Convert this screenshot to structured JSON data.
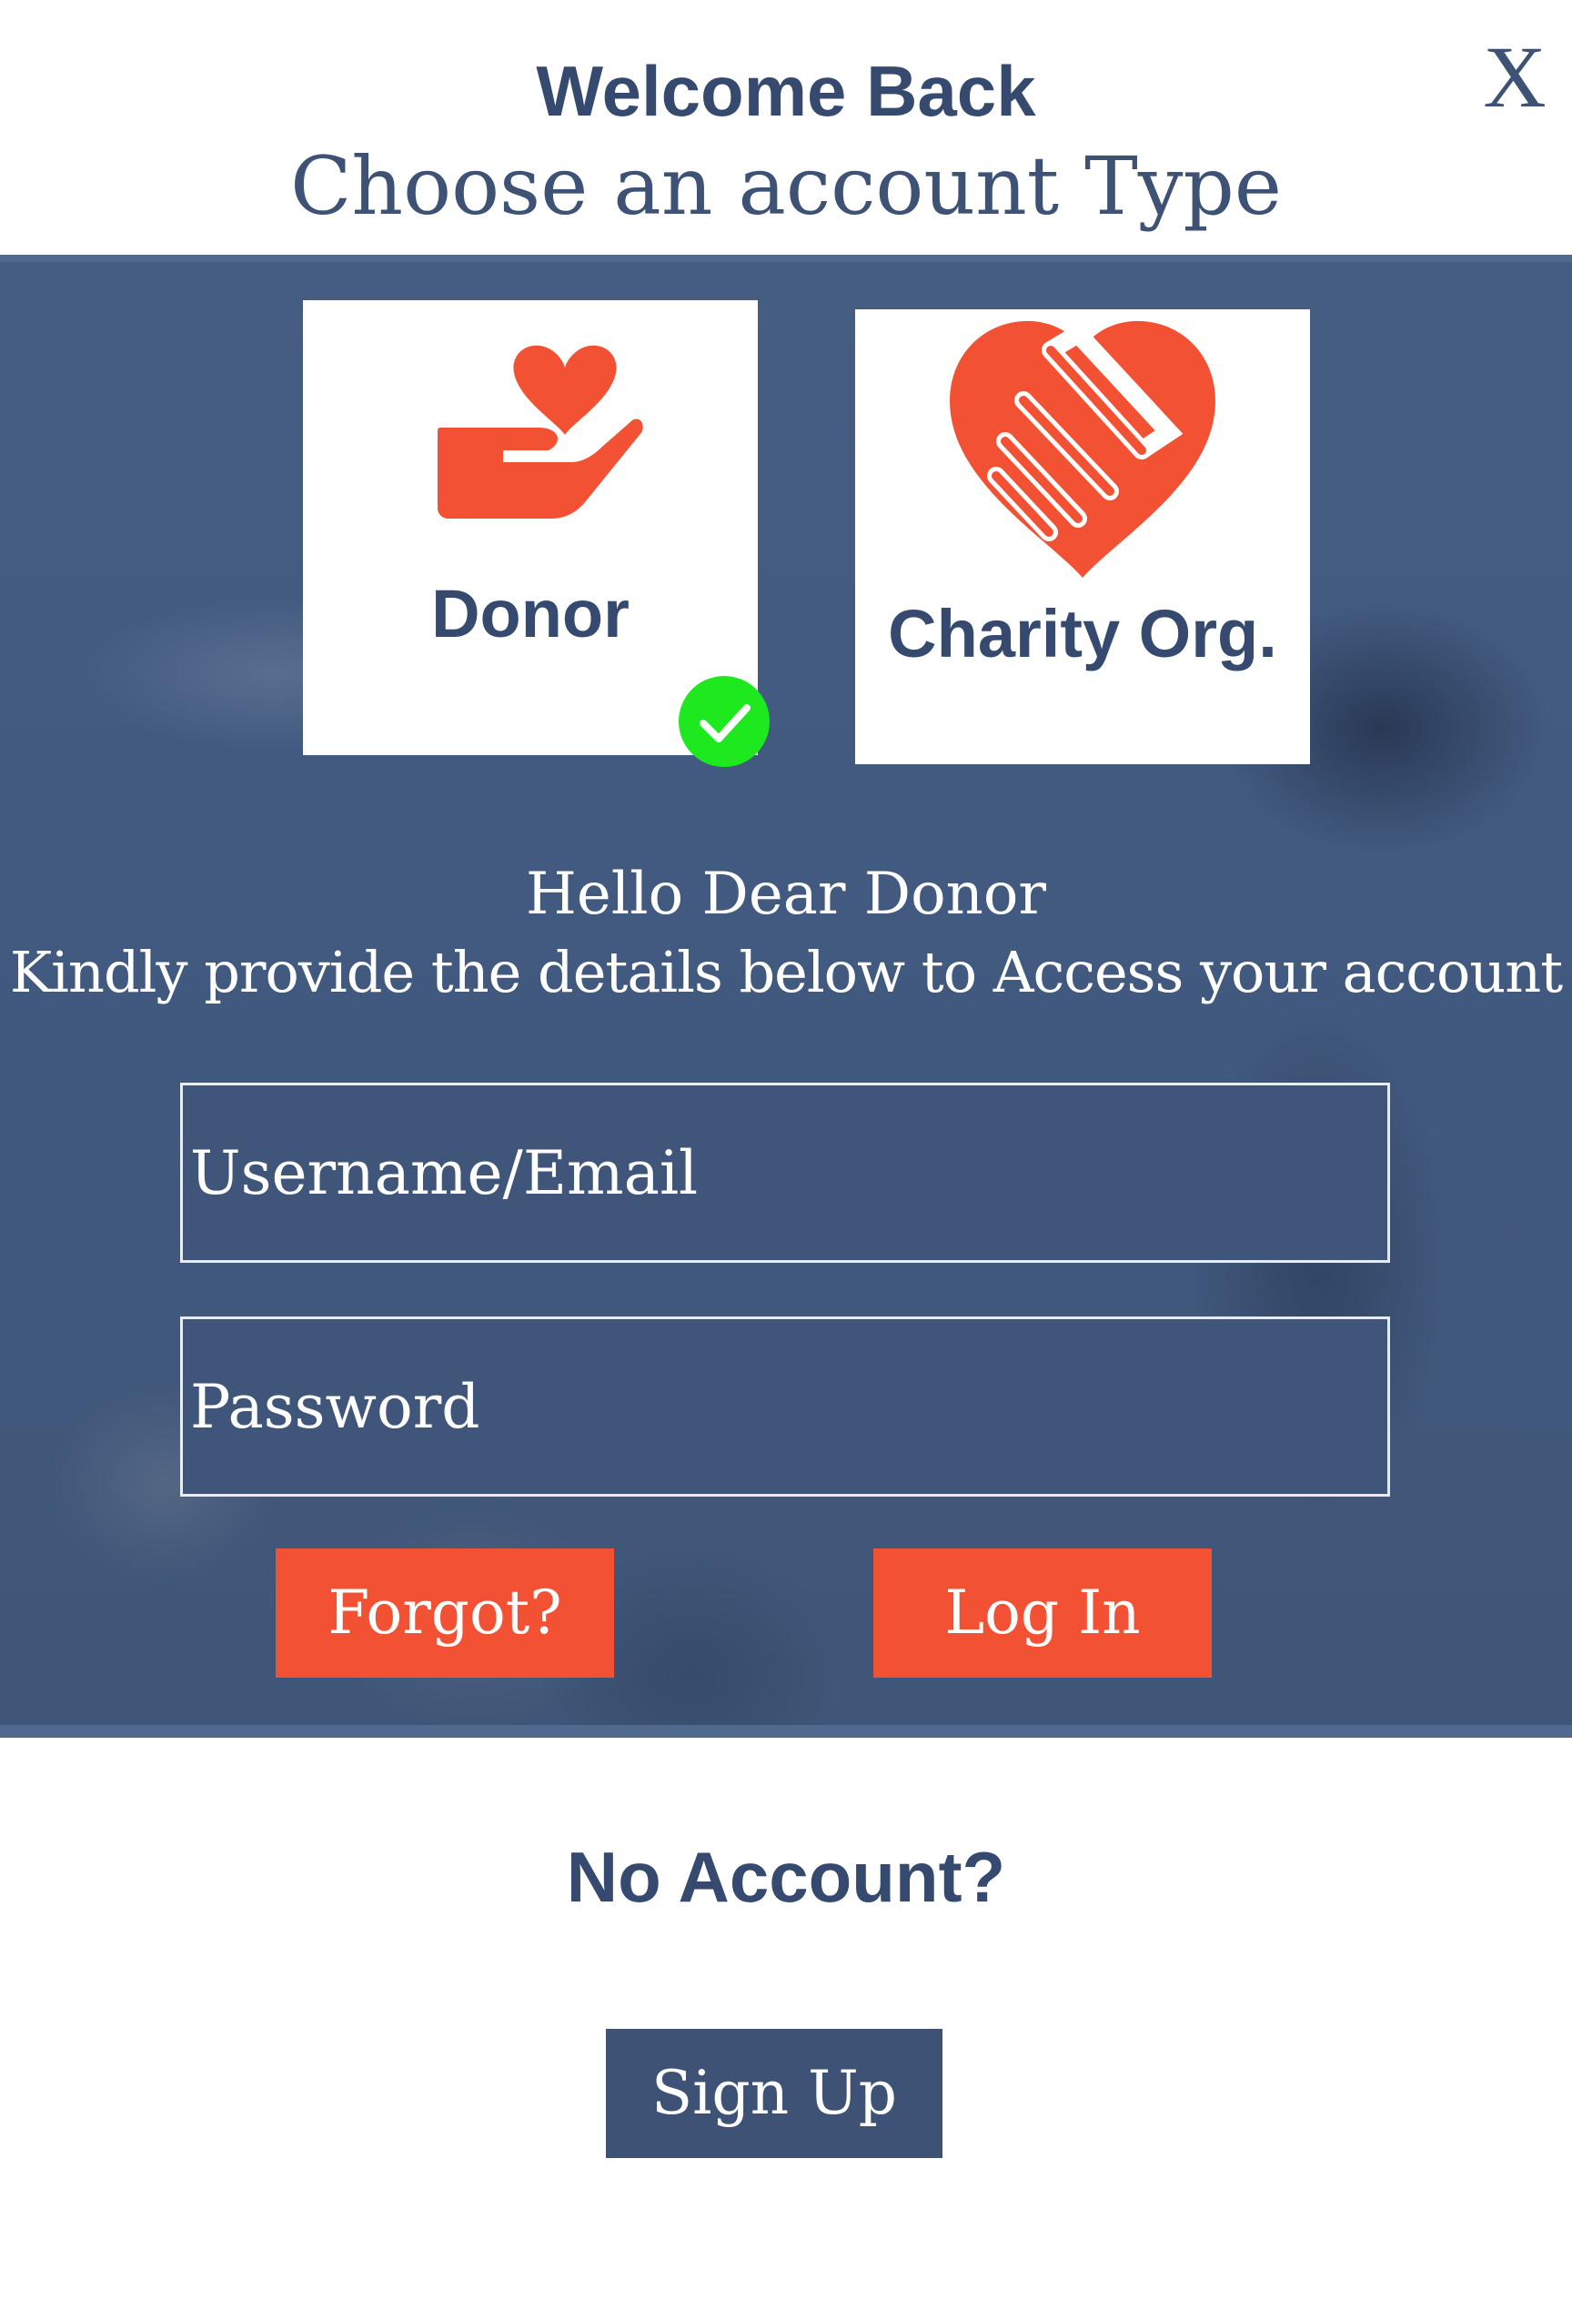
{
  "header": {
    "title": "Welcome Back",
    "subtitle": "Choose an account Type",
    "close_label": "X"
  },
  "account_types": {
    "donor": {
      "label": "Donor",
      "icon": "hand-heart-icon",
      "selected": true
    },
    "charity": {
      "label": "Charity Org.",
      "icon": "handshake-heart-icon",
      "selected": false
    },
    "selected_indicator_icon": "checkmark-circle-icon"
  },
  "greeting": {
    "line1": "Hello Dear Donor",
    "line2": "Kindly provide the details below to Access your account"
  },
  "form": {
    "username_placeholder": "Username/Email",
    "username_value": "",
    "password_placeholder": "Password",
    "password_value": "",
    "forgot_label": "Forgot?",
    "login_label": "Log In"
  },
  "footer": {
    "no_account_text": "No Account?",
    "signup_label": "Sign Up"
  },
  "colors": {
    "navy": "#3d5275",
    "orange": "#f25233",
    "check_green": "#1ee81e",
    "white": "#ffffff"
  }
}
